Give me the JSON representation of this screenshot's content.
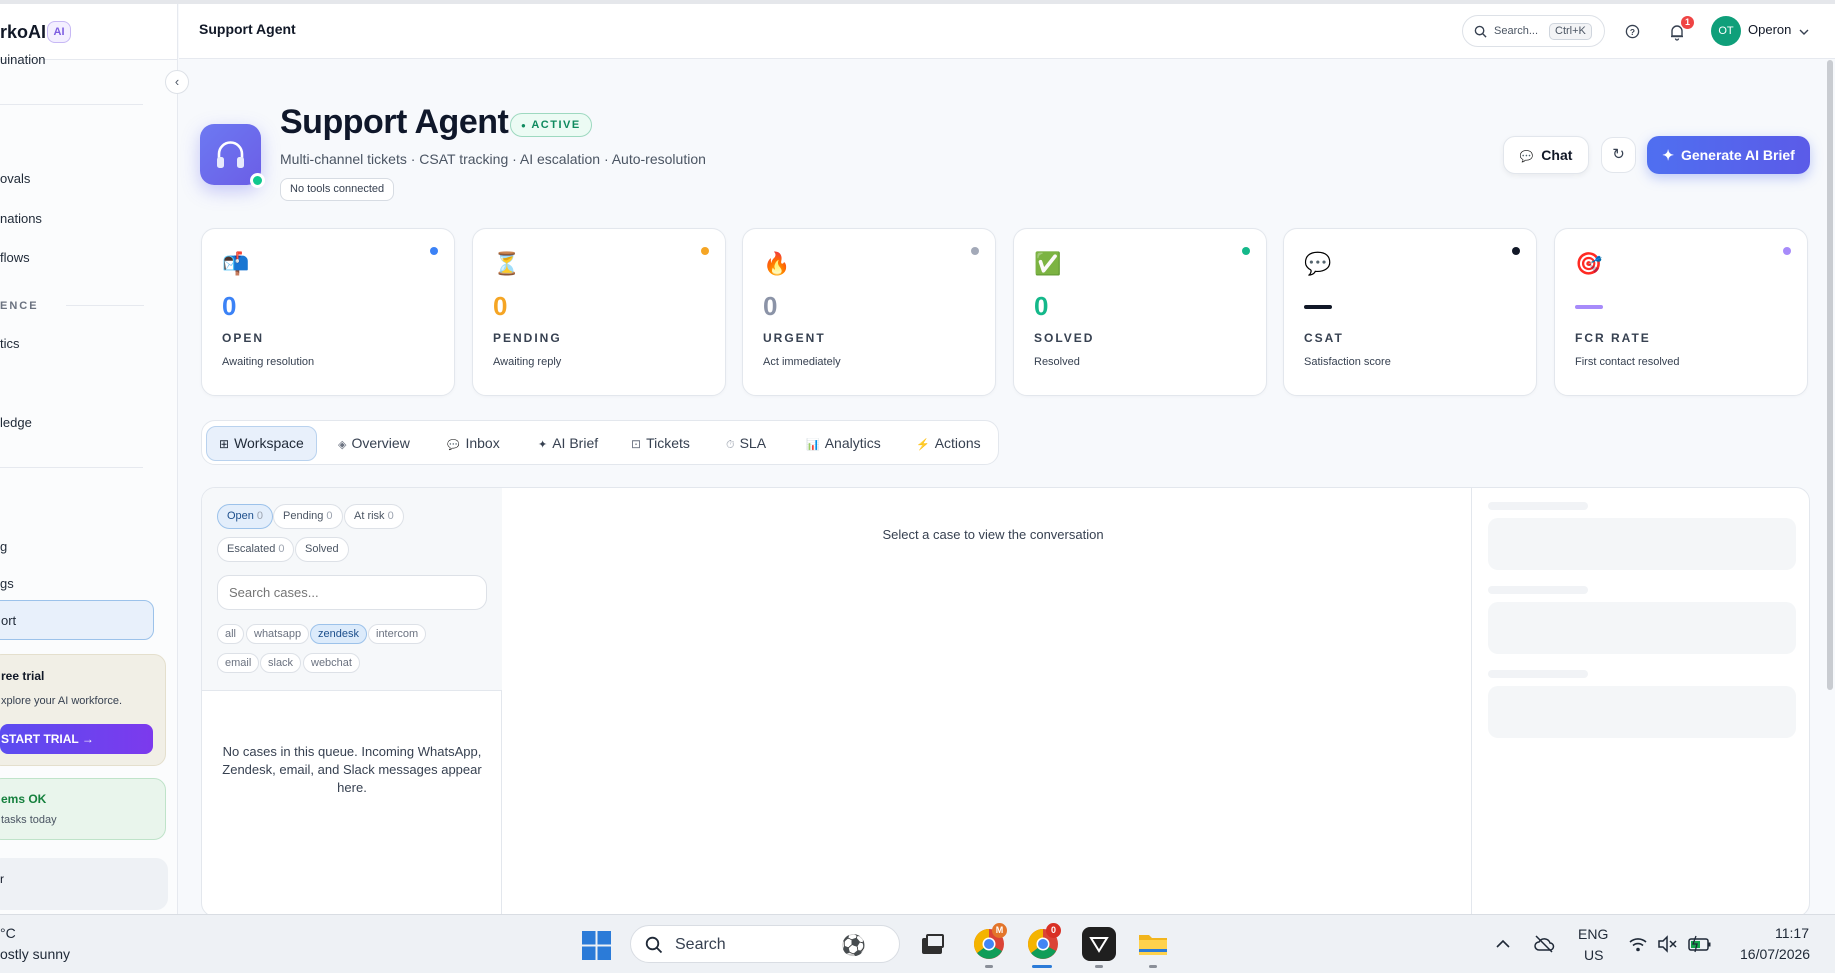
{
  "sidebar": {
    "brand": "rkoAI",
    "brand_badge": "AI",
    "items": [
      {
        "label": "uination"
      },
      {
        "label": "ovals"
      },
      {
        "label": "nations"
      },
      {
        "label": "flows"
      },
      {
        "label": "tics"
      },
      {
        "label": "ledge"
      },
      {
        "label": "g"
      },
      {
        "label": "gs"
      },
      {
        "label": "ort"
      }
    ],
    "section_label": "ENCE",
    "collapse_icon": "‹",
    "trial": {
      "title": "ree trial",
      "text": "xplore your AI workforce.",
      "button": "START TRIAL →"
    },
    "status": {
      "title": "ems OK",
      "text": "tasks today"
    },
    "user_initial": "r"
  },
  "header": {
    "title": "Support Agent",
    "search_placeholder": "Search...",
    "search_shortcut": "Ctrl+K",
    "notification_count": "1",
    "user_initials": "OT",
    "user_name": "Operon"
  },
  "hero": {
    "title": "Support Agent",
    "status": "ACTIVE",
    "subtitle": "Multi-channel tickets · CSAT tracking · AI escalation · Auto-resolution",
    "tools": "No tools connected",
    "chat_label": "Chat",
    "generate_label": "Generate AI Brief"
  },
  "stats": [
    {
      "icon": "📬",
      "value": "0",
      "label": "OPEN",
      "sub": "Awaiting resolution",
      "color": "#3b82f6",
      "dot": "#3b82f6"
    },
    {
      "icon": "⏳",
      "value": "0",
      "label": "PENDING",
      "sub": "Awaiting reply",
      "color": "#f5a524",
      "dot": "#f5a524"
    },
    {
      "icon": "🔥",
      "value": "0",
      "label": "URGENT",
      "sub": "Act immediately",
      "color": "#8b93a7",
      "dot": "#a3a9b8"
    },
    {
      "icon": "✅",
      "value": "0",
      "label": "SOLVED",
      "sub": "Resolved",
      "color": "#14b88a",
      "dot": "#14b88a"
    },
    {
      "icon": "💬",
      "value": "—",
      "label": "CSAT",
      "sub": "Satisfaction score",
      "color": "#111827",
      "dot": "#111827"
    },
    {
      "icon": "🎯",
      "value": "—",
      "label": "FCR RATE",
      "sub": "First contact resolved",
      "color": "#a78bfa",
      "dot": "#a78bfa"
    }
  ],
  "tabs": [
    {
      "icon": "⊞",
      "label": "Workspace"
    },
    {
      "icon": "◈",
      "label": "Overview"
    },
    {
      "icon": "💬",
      "label": "Inbox"
    },
    {
      "icon": "✦",
      "label": "AI Brief"
    },
    {
      "icon": "⊡",
      "label": "Tickets"
    },
    {
      "icon": "⏱",
      "label": "SLA"
    },
    {
      "icon": "📊",
      "label": "Analytics"
    },
    {
      "icon": "⚡",
      "label": "Actions"
    }
  ],
  "workspace": {
    "queues": [
      {
        "label": "Open",
        "count": "0"
      },
      {
        "label": "Pending",
        "count": "0"
      },
      {
        "label": "At risk",
        "count": "0"
      },
      {
        "label": "Escalated",
        "count": "0"
      },
      {
        "label": "Solved",
        "count": ""
      }
    ],
    "search_placeholder": "Search cases...",
    "channels": [
      "all",
      "whatsapp",
      "zendesk",
      "intercom",
      "email",
      "slack",
      "webchat"
    ],
    "empty_queue": "No cases in this queue. Incoming WhatsApp, Zendesk, email, and Slack messages appear here.",
    "empty_conversation": "Select a case to view the conversation"
  },
  "taskbar": {
    "weather_temp": "°C",
    "weather_text": "ostly sunny",
    "search_label": "Search",
    "lang": "ENG",
    "region": "US",
    "time": "11:17",
    "date": "16/07/2026",
    "chrome_badge": "0",
    "gmail_badge": "M"
  }
}
